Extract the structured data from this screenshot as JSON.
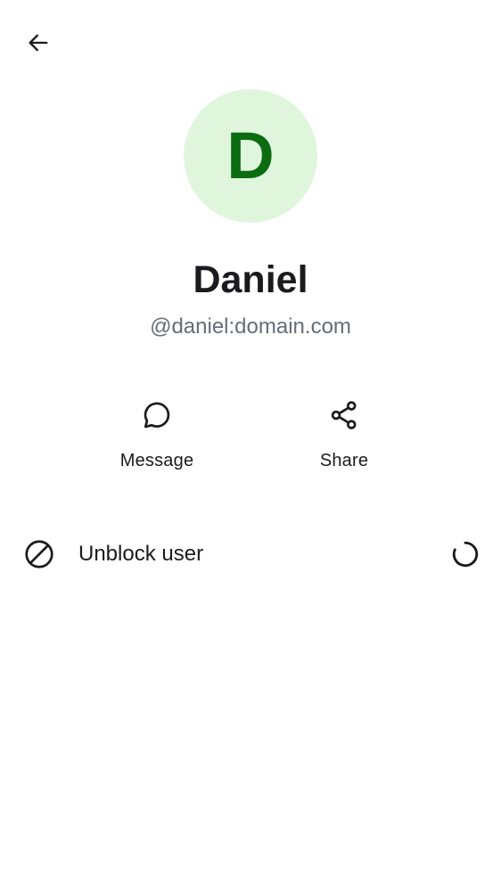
{
  "toolbar": {
    "back_icon": "arrow-left-icon"
  },
  "profile": {
    "avatar_letter": "D",
    "avatar_bg": "#dff6dc",
    "avatar_fg": "#0b6c12",
    "display_name": "Daniel",
    "user_id": "@daniel:domain.com"
  },
  "actions": [
    {
      "label": "Message",
      "icon": "chat-bubble-icon"
    },
    {
      "label": "Share",
      "icon": "share-icon"
    }
  ],
  "settings": {
    "unblock_label": "Unblock user",
    "unblock_icon": "block-icon",
    "loading_icon": "spinner-icon"
  }
}
